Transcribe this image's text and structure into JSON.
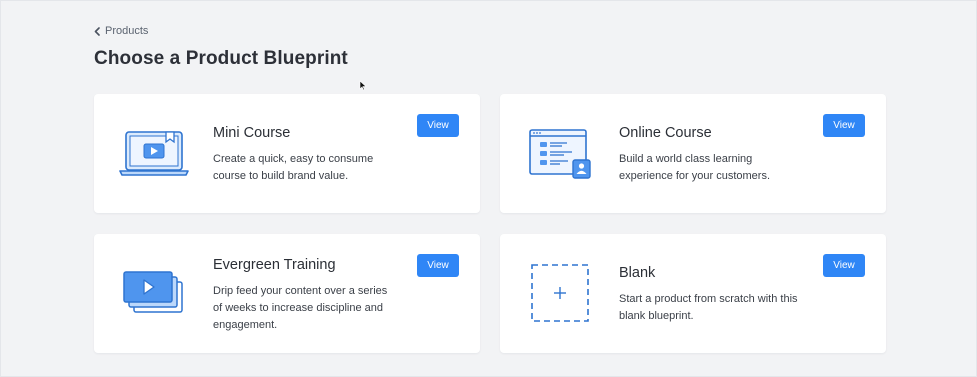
{
  "breadcrumb": {
    "label": "Products",
    "icon": "chevron-left-icon"
  },
  "page": {
    "title": "Choose a Product Blueprint"
  },
  "accent_color": "#2f86f6",
  "cards": [
    {
      "title": "Mini Course",
      "description": "Create a quick, easy to consume course to build brand value.",
      "button": "View",
      "icon": "laptop-video-icon"
    },
    {
      "title": "Online Course",
      "description": "Build a world class learning experience for your customers.",
      "button": "View",
      "icon": "browser-course-icon"
    },
    {
      "title": "Evergreen Training",
      "description": "Drip feed your content over a series of weeks to increase discipline and engagement.",
      "button": "View",
      "icon": "stacked-videos-icon"
    },
    {
      "title": "Blank",
      "description": "Start a product from scratch with this blank blueprint.",
      "button": "View",
      "icon": "dashed-plus-icon"
    }
  ]
}
